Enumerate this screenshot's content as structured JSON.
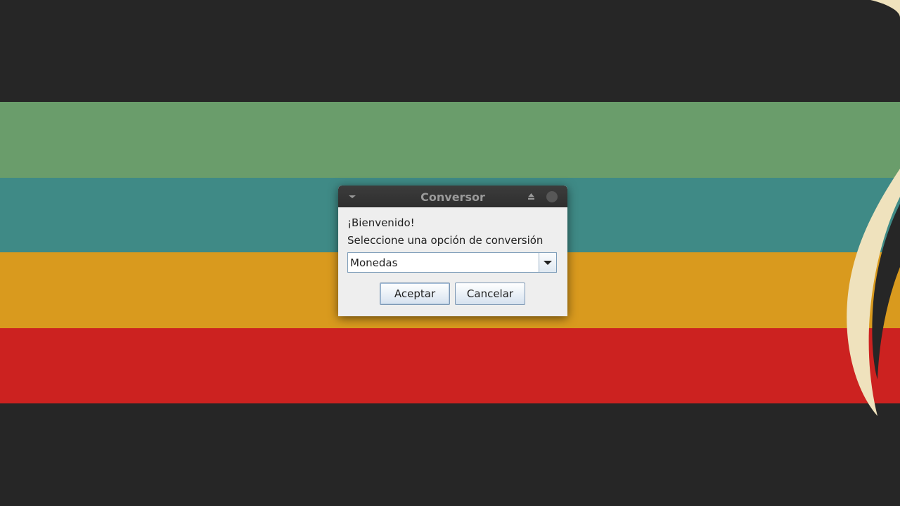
{
  "wallpaper": {
    "background_color": "#262626",
    "stripes": [
      "#6a9d6b",
      "#3f8a86",
      "#d99a1e",
      "#cc2220"
    ]
  },
  "dialog": {
    "title": "Conversor",
    "icons": {
      "menu": "chevron-down-icon",
      "maximize": "maximize-icon",
      "close": "close-icon"
    },
    "welcome_text": "¡Bienvenido!",
    "prompt_text": "Seleccione una opción de conversión",
    "select": {
      "selected_value": "Monedas"
    },
    "buttons": {
      "accept_label": "Aceptar",
      "cancel_label": "Cancelar"
    }
  }
}
